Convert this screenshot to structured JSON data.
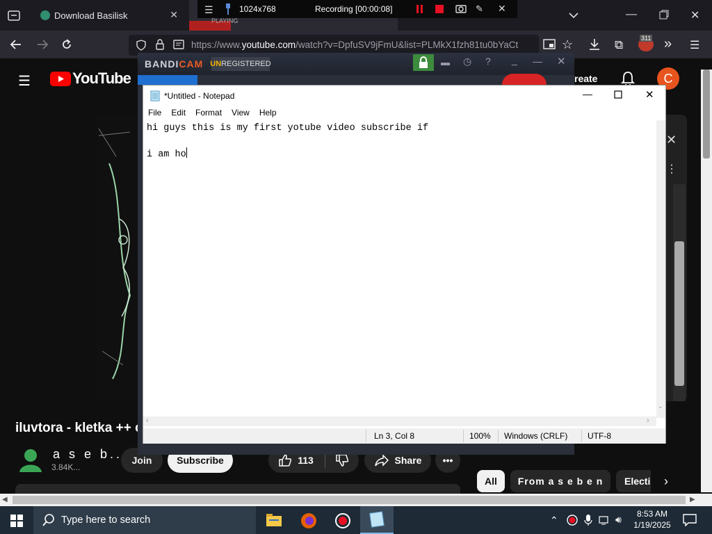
{
  "browser": {
    "tabs": [
      {
        "label": "Download Basilisk"
      },
      {
        "label": "PLAYING"
      }
    ],
    "url_prefix": "https://www.",
    "url_domain": "youtube.com",
    "url_rest": "/watch?v=DpfuSV9jFmU&list=PLMkX1fzh81tu0bYaCt",
    "badge_count": "311"
  },
  "recorder": {
    "resolution": "1024x768",
    "status": "Recording [00:00:08]"
  },
  "youtube": {
    "logo_text": "YouTube",
    "create_label": "reate",
    "avatar_letter": "C",
    "video_title": "iluvtora - kletka ++ c",
    "channel_name": "a s e b...",
    "subscriber_count": "3.84K...",
    "join_label": "Join",
    "subscribe_label": "Subscribe",
    "like_count": "113",
    "share_label": "Share",
    "chips": [
      "All",
      "From a s e b e n",
      "Electi"
    ]
  },
  "bandicam": {
    "logo_part1": "BANDI",
    "logo_part2": "CAM",
    "unreg_prefix": "UN",
    "unreg_rest": "REGISTERED"
  },
  "notepad": {
    "title": "*Untitled - Notepad",
    "menu": [
      "File",
      "Edit",
      "Format",
      "View",
      "Help"
    ],
    "line1": "hi guys this is my first yotube video subscribe if",
    "line2": "",
    "line3": "i am ho",
    "status": {
      "position": "Ln 3, Col 8",
      "zoom": "100%",
      "line_ending": "Windows (CRLF)",
      "encoding": "UTF-8"
    }
  },
  "taskbar": {
    "search_placeholder": "Type here to search",
    "time": "8:53 AM",
    "date": "1/19/2025"
  },
  "colors": {
    "youtube_red": "#ff0000",
    "bandicam_orange": "#ea5b23",
    "record_red": "#e81123"
  }
}
